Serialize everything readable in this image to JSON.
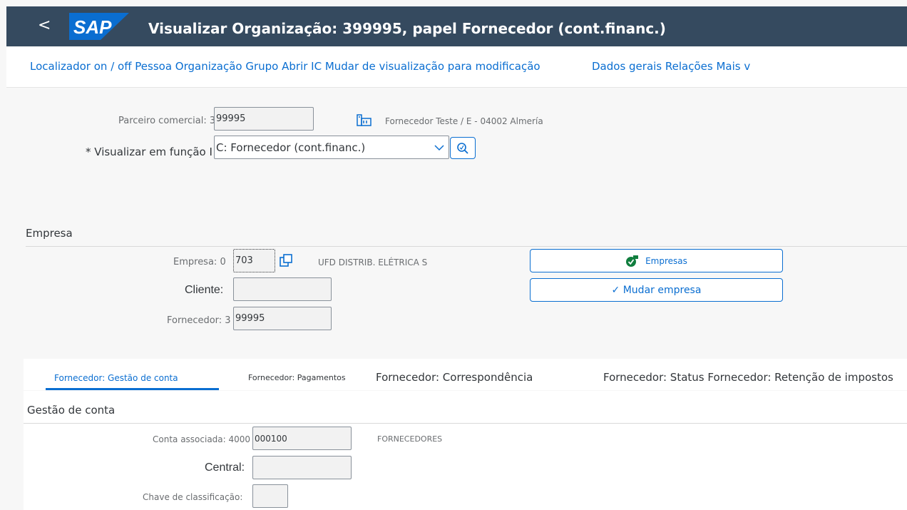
{
  "shell": {
    "back_label": "<",
    "logo_text": "SAP",
    "title": "Visualizar Organização: 399995, papel Fornecedor (cont.financ.)"
  },
  "toolbar": {
    "items": [
      "Localizador on / off Pessoa Organização Grupo Abrir IC Mudar de visualização para modificação",
      "Dados gerais Relações Mais v"
    ]
  },
  "header": {
    "partner_label": "Parceiro comercial: 3",
    "partner_value": "99995",
    "partner_description": "Fornecedor Teste / E - 04002 Almería",
    "role_label": "* Visualizar em função I",
    "role_value": "C: Fornecedor (cont.financ.)"
  },
  "empresa": {
    "section_title": "Empresa",
    "company_label": "Empresa: 0",
    "company_value": "703",
    "company_description": "UFD DISTRIB. ELÉTRICA S",
    "cliente_label": "Cliente:",
    "cliente_value": "",
    "fornecedor_label": "Fornecedor: 3",
    "fornecedor_value": "99995",
    "btn_empresas": "Empresas",
    "btn_mudar": "✓ Mudar empresa"
  },
  "tabs": [
    "Fornecedor: Gestão de conta",
    "Fornecedor: Pagamentos",
    "Fornecedor: Correspondência",
    "Fornecedor: Status Fornecedor: Retenção de impostos"
  ],
  "gestao": {
    "section_title": "Gestão de conta",
    "conta_label": "Conta associada: 4000",
    "conta_value": "000100",
    "conta_description": "FORNECEDORES",
    "central_label": "Central:",
    "central_value": "",
    "chave_label": "Chave de classificação:",
    "chave_value": ""
  },
  "colors": {
    "shell": "#354a5f",
    "link": "#0a6ed1",
    "tab_selected": "#0a6ed1"
  }
}
